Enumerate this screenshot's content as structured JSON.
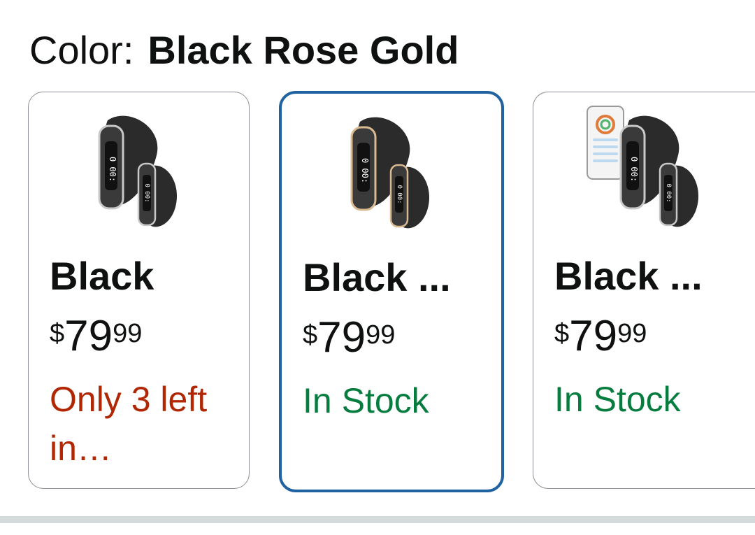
{
  "header": {
    "label": "Color:",
    "selected_value": "Black Rose Gold"
  },
  "options": [
    {
      "name": "Black",
      "price": {
        "symbol": "$",
        "whole": "79",
        "fraction": "99"
      },
      "availability": "Only 3 left in…",
      "availability_color": "#b12704",
      "selected": false,
      "image_icon": "fitness-band-pair-silver-icon"
    },
    {
      "name": "Black ...",
      "price": {
        "symbol": "$",
        "whole": "79",
        "fraction": "99"
      },
      "availability": "In Stock",
      "availability_color": "#067d3e",
      "selected": true,
      "image_icon": "fitness-band-pair-rose-gold-icon"
    },
    {
      "name": "Black ...",
      "price": {
        "symbol": "$",
        "whole": "79",
        "fraction": "99"
      },
      "availability": "In Stock",
      "availability_color": "#067d3e",
      "selected": false,
      "image_icon": "fitness-band-pair-with-phone-icon"
    }
  ],
  "colors": {
    "selected_border": "#2162a1",
    "card_border": "#8d9096",
    "price_text": "#0f1111"
  }
}
